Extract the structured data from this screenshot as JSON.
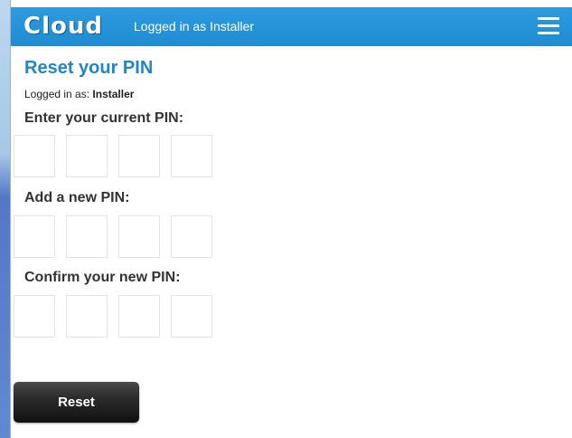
{
  "header": {
    "logo": "Cloud",
    "logged_in_text": "Logged in as Installer"
  },
  "main": {
    "title": "Reset your PIN",
    "logged_in_prefix": "Logged in as:",
    "logged_in_user": "Installer",
    "sections": [
      {
        "label": "Enter your current PIN:"
      },
      {
        "label": "Add a new PIN:"
      },
      {
        "label": "Confirm your new PIN:"
      }
    ],
    "reset_label": "Reset"
  },
  "icons": {
    "menu": "hamburger-menu-icon"
  },
  "colors": {
    "header_bg": "#1f8bd2",
    "title": "#1f86c9",
    "button_bg": "#1a1a1a"
  }
}
